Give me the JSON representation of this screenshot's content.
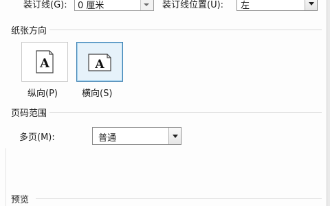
{
  "gutter": {
    "label": "装订线(G):",
    "value": "0 厘米"
  },
  "gutter_position": {
    "label": "装订线位置(U):",
    "value": "左"
  },
  "orientation": {
    "title": "纸张方向",
    "options": [
      {
        "label": "纵向(P)",
        "icon_letter": "A",
        "selected": false
      },
      {
        "label": "横向(S)",
        "icon_letter": "A",
        "selected": true
      }
    ]
  },
  "pages": {
    "title": "页码范围",
    "multiple_label": "多页(M):",
    "multiple_value": "普通"
  },
  "preview": {
    "title": "预览"
  }
}
